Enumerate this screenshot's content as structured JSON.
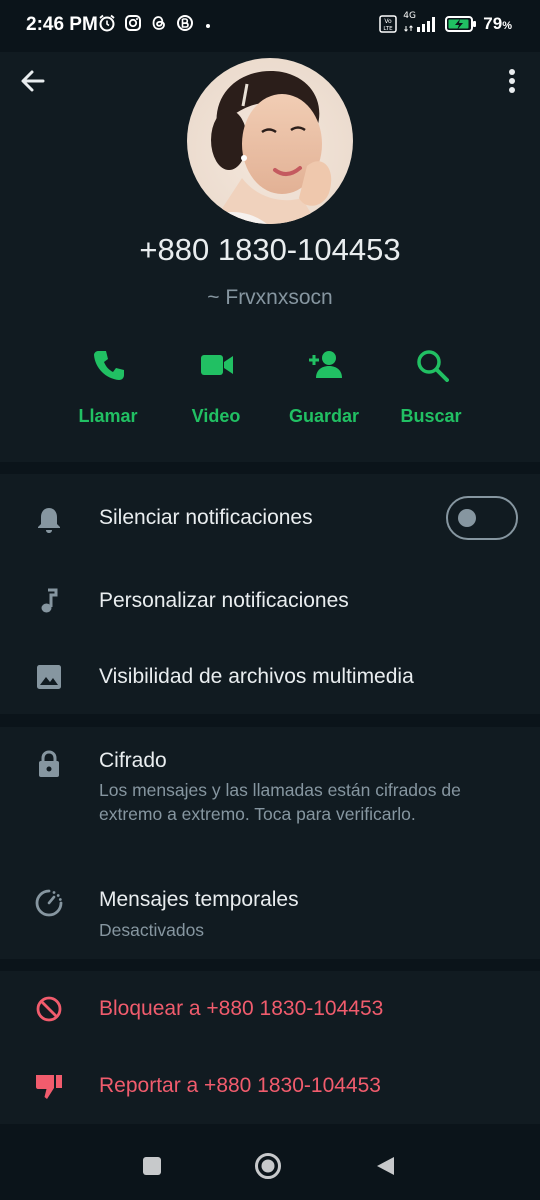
{
  "status_bar": {
    "time": "2:46 PM",
    "network_label": "4G",
    "battery_percent": "79",
    "battery_unit": "%"
  },
  "contact": {
    "phone": "+880 1830-104453",
    "name": "~ Frvxnxsocn"
  },
  "actions": [
    {
      "label": "Llamar",
      "icon": "phone-icon"
    },
    {
      "label": "Video",
      "icon": "video-camera-icon"
    },
    {
      "label": "Guardar",
      "icon": "add-contact-icon"
    },
    {
      "label": "Buscar",
      "icon": "search-icon"
    }
  ],
  "settings": {
    "mute": "Silenciar notificaciones",
    "custom": "Personalizar notificaciones",
    "media": "Visibilidad de archivos multimedia"
  },
  "privacy": {
    "encryption_title": "Cifrado",
    "encryption_desc": "Los mensajes y las llamadas están cifrados de extremo a extremo. Toca para verificarlo.",
    "temp_title": "Mensajes temporales",
    "temp_value": "Desactivados"
  },
  "danger": {
    "block": "Bloquear a +880 1830-104453",
    "report": "Reportar a +880 1830-104453"
  },
  "colors": {
    "accent": "#21c063",
    "danger": "#f15c6d",
    "background": "#0b141a",
    "surface": "#111b21"
  },
  "toggles": {
    "mute_on": false
  }
}
